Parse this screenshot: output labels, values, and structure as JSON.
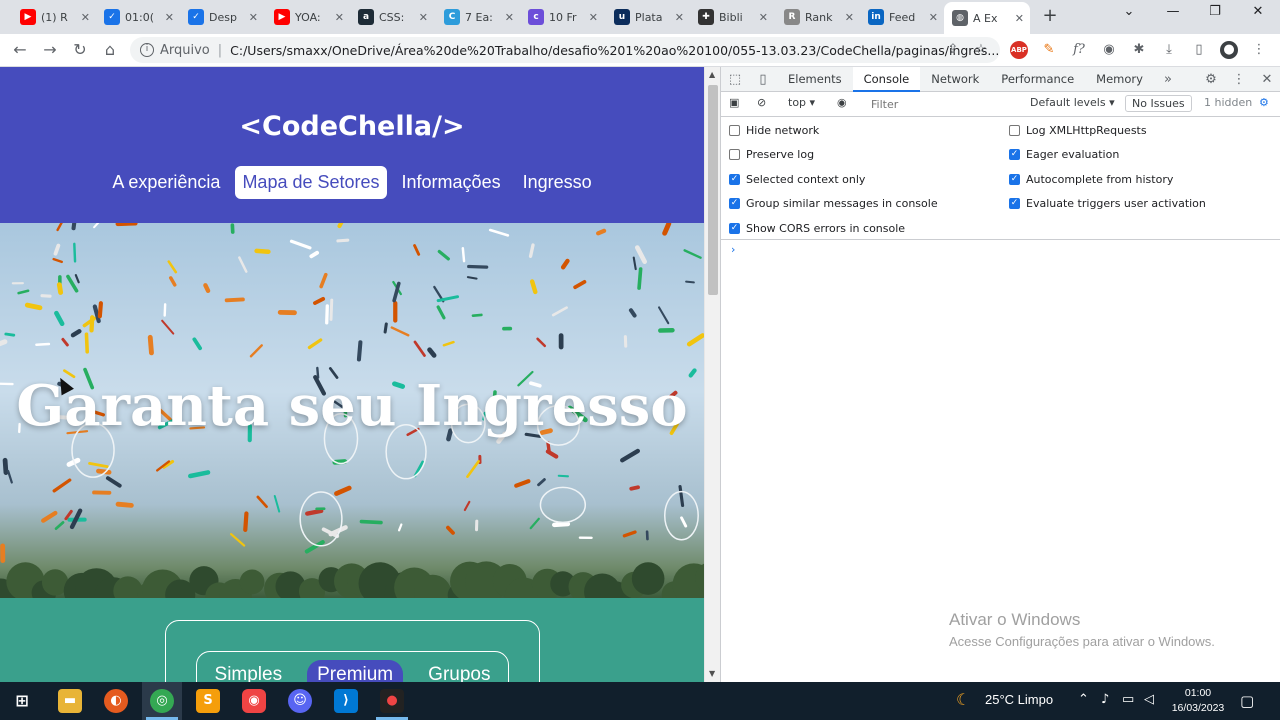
{
  "browser": {
    "tabs": [
      {
        "title": "(1) R",
        "icon": "youtube-icon",
        "color": "#ff0000",
        "glyph": "▶"
      },
      {
        "title": "01:0(",
        "icon": "check-circle-icon",
        "color": "#1a73e8",
        "glyph": "✓"
      },
      {
        "title": "Desp",
        "icon": "check-circle-icon",
        "color": "#1a73e8",
        "glyph": "✓"
      },
      {
        "title": "YOA:",
        "icon": "youtube-icon",
        "color": "#ff0000",
        "glyph": "▶"
      },
      {
        "title": "CSS:",
        "icon": "a-logo-icon",
        "color": "#1d2b36",
        "glyph": "a"
      },
      {
        "title": "7 Ea:",
        "icon": "css-icon",
        "color": "#2d9cdb",
        "glyph": "C"
      },
      {
        "title": "10 Fr",
        "icon": "cl-logo-icon",
        "color": "#6c4ed9",
        "glyph": "c"
      },
      {
        "title": "Plata",
        "icon": "u-logo-icon",
        "color": "#0c2d5c",
        "glyph": "u"
      },
      {
        "title": "Bibli",
        "icon": "plus-logo-icon",
        "color": "#333333",
        "glyph": "✚"
      },
      {
        "title": "Rank",
        "icon": "ranking-icon",
        "color": "#888888",
        "glyph": "R"
      },
      {
        "title": "Feed",
        "icon": "linkedin-icon",
        "color": "#0a66c2",
        "glyph": "in"
      },
      {
        "title": "A Ex",
        "icon": "globe-icon",
        "color": "#5f6368",
        "glyph": "◍"
      }
    ],
    "active_tab_index": 11,
    "scheme_label": "Arquivo",
    "url": "C:/Users/smaxx/OneDrive/Área%20de%20Trabalho/desafio%201%20ao%20100/055-13.03.23/CodeChella/paginas/ingres..."
  },
  "site": {
    "logo": "<CodeChella/>",
    "nav": [
      {
        "label": "A experiência",
        "active": false
      },
      {
        "label": "Mapa de Setores",
        "active": true
      },
      {
        "label": "Informações",
        "active": false
      },
      {
        "label": "Ingresso",
        "active": false
      }
    ],
    "hero_title": "Garanta seu Ingresso",
    "ticket_tabs": [
      {
        "label": "Simples",
        "active": false
      },
      {
        "label": "Premium",
        "active": true
      },
      {
        "label": "Grupos",
        "active": false
      }
    ],
    "colors": {
      "header": "#464cbd",
      "section": "#3aa08c"
    }
  },
  "devtools": {
    "tabs": [
      "Elements",
      "Console",
      "Network",
      "Performance",
      "Memory"
    ],
    "active_tab": "Console",
    "context": "top",
    "filter_placeholder": "Filter",
    "levels": "Default levels",
    "issues": "No Issues",
    "hidden": "1 hidden",
    "settings_left": [
      {
        "label": "Hide network",
        "checked": false
      },
      {
        "label": "Preserve log",
        "checked": false
      },
      {
        "label": "Selected context only",
        "checked": true
      },
      {
        "label": "Group similar messages in console",
        "checked": true
      },
      {
        "label": "Show CORS errors in console",
        "checked": true
      }
    ],
    "settings_right": [
      {
        "label": "Log XMLHttpRequests",
        "checked": false
      },
      {
        "label": "Eager evaluation",
        "checked": true
      },
      {
        "label": "Autocomplete from history",
        "checked": true
      },
      {
        "label": "Evaluate triggers user activation",
        "checked": true
      }
    ],
    "prompt": "›"
  },
  "watermark": {
    "line1": "Ativar o Windows",
    "line2": "Acesse Configurações para ativar o Windows."
  },
  "taskbar": {
    "weather": "25°C  Limpo",
    "time": "01:00",
    "date": "16/03/2023"
  }
}
